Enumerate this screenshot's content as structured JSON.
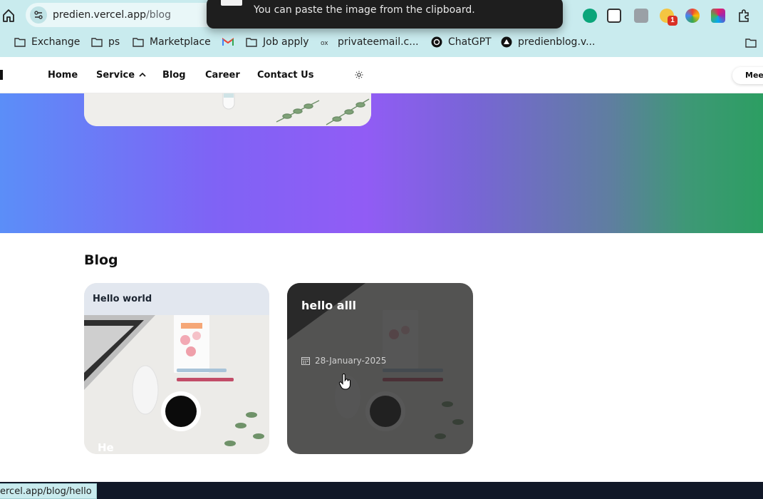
{
  "browser": {
    "url_host": "predien.vercel.app",
    "url_path": "/blog",
    "toast_message": "You can paste the image from the clipboard.",
    "extension_badge": "1",
    "status_url": "ercel.app/blog/hello",
    "bookmarks": [
      "Exchange",
      "ps",
      "Marketplace",
      "Job apply",
      "privateemail.c...",
      "ChatGPT",
      "predienblog.v..."
    ]
  },
  "nav": {
    "items": [
      "Home",
      "Service",
      "Blog",
      "Career",
      "Contact Us"
    ],
    "cta": "Mee"
  },
  "blog": {
    "heading": "Blog",
    "cards": [
      {
        "title": "Hello world",
        "footer_text": "He"
      },
      {
        "title": "hello alll",
        "date": "28-January-2025"
      }
    ]
  },
  "colors": {
    "chrome_bg": "#c9ebee",
    "hero_gradient": [
      "#5b8ef8",
      "#915cf5",
      "#2c9e62"
    ],
    "footer_bg": "#111827"
  }
}
